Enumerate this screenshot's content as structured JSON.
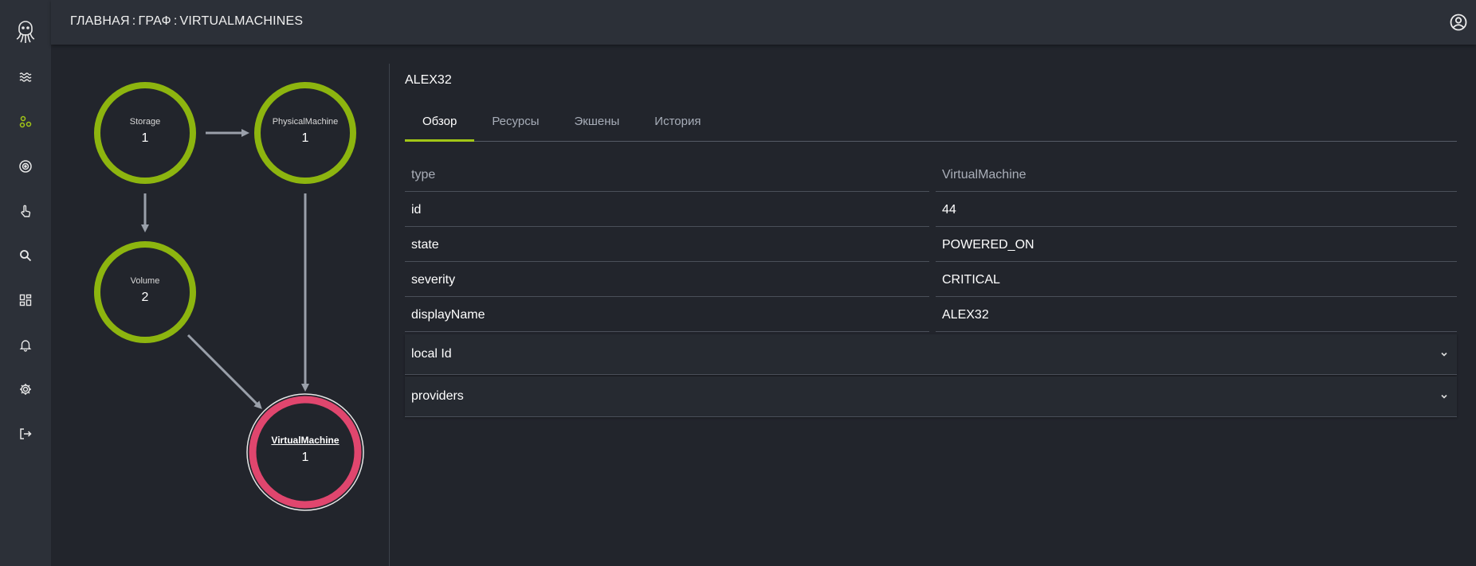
{
  "breadcrumb": {
    "home": "ГЛАВНАЯ",
    "graph": "ГРАФ",
    "current": "VIRTUALMACHINES",
    "separator": ":"
  },
  "colors": {
    "accent": "#a2c617",
    "node_ok": "#8db50f",
    "node_critical": "#e0466e",
    "edge": "#9aa0aa"
  },
  "sidebar": {
    "items": [
      {
        "icon": "waves-icon"
      },
      {
        "icon": "graph-icon",
        "active": true
      },
      {
        "icon": "target-icon"
      },
      {
        "icon": "touch-icon"
      },
      {
        "icon": "search-icon"
      },
      {
        "icon": "dashboard-icon"
      },
      {
        "icon": "bell-icon"
      },
      {
        "icon": "gear-icon"
      },
      {
        "icon": "logout-icon"
      }
    ]
  },
  "graph": {
    "nodes": [
      {
        "id": "storage",
        "name": "Storage",
        "count": "1",
        "status": "ok"
      },
      {
        "id": "physical",
        "name": "PhysicalMachine",
        "count": "1",
        "status": "ok"
      },
      {
        "id": "volume",
        "name": "Volume",
        "count": "2",
        "status": "ok"
      },
      {
        "id": "vm",
        "name": "VirtualMachine",
        "count": "1",
        "status": "critical",
        "selected": true
      }
    ],
    "edges": [
      {
        "from": "storage",
        "to": "physical"
      },
      {
        "from": "storage",
        "to": "volume"
      },
      {
        "from": "physical",
        "to": "vm"
      },
      {
        "from": "volume",
        "to": "vm"
      }
    ]
  },
  "details": {
    "title": "ALEX32",
    "tabs": [
      "Обзор",
      "Ресурсы",
      "Экшены",
      "История"
    ],
    "active_tab": 0,
    "header": {
      "key": "type",
      "value": "VirtualMachine"
    },
    "rows": [
      {
        "key": "id",
        "value": "44"
      },
      {
        "key": "state",
        "value": "POWERED_ON"
      },
      {
        "key": "severity",
        "value": "CRITICAL"
      },
      {
        "key": "displayName",
        "value": "ALEX32"
      }
    ],
    "accordions": [
      "local Id",
      "providers"
    ]
  }
}
